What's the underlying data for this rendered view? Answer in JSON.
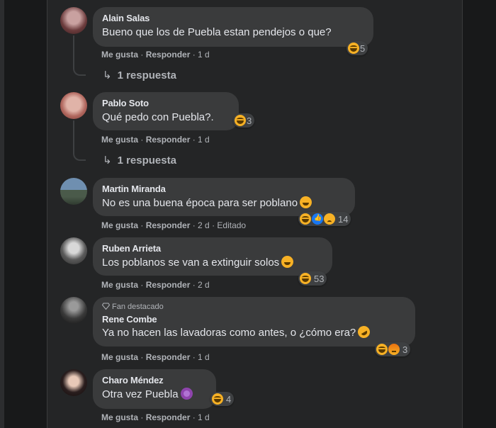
{
  "comments": [
    {
      "name": "Alain Salas",
      "text": "Bueno que los de Puebla estan pendejos o que?",
      "like": "Me gusta",
      "reply": "Responder",
      "time": "1 d",
      "reactions": [
        "haha"
      ],
      "count": "5",
      "replies": "1 respuesta"
    },
    {
      "name": "Pablo Soto",
      "text": "Qué pedo con Puebla?.",
      "like": "Me gusta",
      "reply": "Responder",
      "time": "1 d",
      "reactions": [
        "haha"
      ],
      "count": "3",
      "replies": "1 respuesta"
    },
    {
      "name": "Martin Miranda",
      "text": "No es una buena época para ser poblano",
      "like": "Me gusta",
      "reply": "Responder",
      "time": "2 d",
      "edited": "Editado",
      "reactions": [
        "haha",
        "like",
        "sad"
      ],
      "count": "14"
    },
    {
      "name": "Ruben Arrieta",
      "text": "Los poblanos se van a extinguir solos",
      "like": "Me gusta",
      "reply": "Responder",
      "time": "2 d",
      "reactions": [
        "haha"
      ],
      "count": "53"
    },
    {
      "badge": "Fan destacado",
      "name": "Rene Combe",
      "text": "Ya no hacen las lavadoras como antes, o ¿cómo era?",
      "like": "Me gusta",
      "reply": "Responder",
      "time": "1 d",
      "reactions": [
        "haha",
        "angry"
      ],
      "count": "3"
    },
    {
      "name": "Charo Méndez",
      "text": "Otra vez Puebla",
      "like": "Me gusta",
      "reply": "Responder",
      "time": "1 d",
      "reactions": [
        "haha"
      ],
      "count": "4"
    }
  ],
  "colors": {
    "bg": "#242526",
    "bubble": "#3a3b3c",
    "text": "#e4e6eb",
    "muted": "#b0b3b8"
  }
}
